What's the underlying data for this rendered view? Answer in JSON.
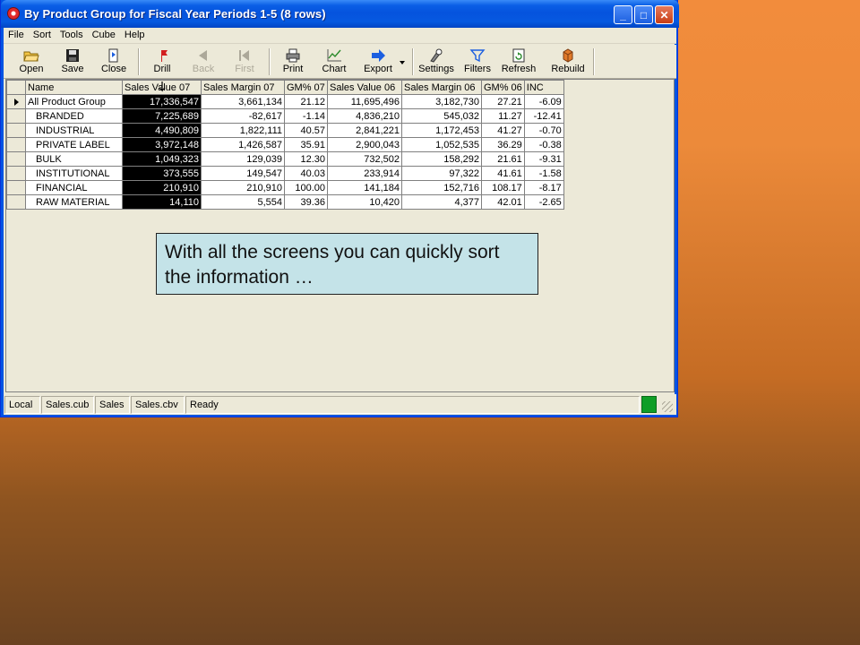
{
  "window": {
    "title": "By Product Group for Fiscal Year Periods 1-5  (8 rows)",
    "controls": {
      "minimize": "_",
      "maximize": "□",
      "close": "✕"
    }
  },
  "menu": [
    "File",
    "Sort",
    "Tools",
    "Cube",
    "Help"
  ],
  "toolbar": {
    "open": "Open",
    "save": "Save",
    "close": "Close",
    "drill": "Drill",
    "back": "Back",
    "first": "First",
    "print": "Print",
    "chart": "Chart",
    "export": "Export",
    "settings": "Settings",
    "filters": "Filters",
    "refresh": "Refresh",
    "rebuild": "Rebuild"
  },
  "grid": {
    "headers": [
      "Name",
      "Sales Value 07",
      "Sales Margin 07",
      "GM% 07",
      "Sales Value 06",
      "Sales Margin 06",
      "GM% 06",
      "INC"
    ],
    "rows": [
      [
        "All Product Group",
        "17,336,547",
        "3,661,134",
        "21.12",
        "11,695,496",
        "3,182,730",
        "27.21",
        "-6.09"
      ],
      [
        "BRANDED",
        "7,225,689",
        "-82,617",
        "-1.14",
        "4,836,210",
        "545,032",
        "11.27",
        "-12.41"
      ],
      [
        "INDUSTRIAL",
        "4,490,809",
        "1,822,111",
        "40.57",
        "2,841,221",
        "1,172,453",
        "41.27",
        "-0.70"
      ],
      [
        "PRIVATE LABEL",
        "3,972,148",
        "1,426,587",
        "35.91",
        "2,900,043",
        "1,052,535",
        "36.29",
        "-0.38"
      ],
      [
        "BULK",
        "1,049,323",
        "129,039",
        "12.30",
        "732,502",
        "158,292",
        "21.61",
        "-9.31"
      ],
      [
        "INSTITUTIONAL",
        "373,555",
        "149,547",
        "40.03",
        "233,914",
        "97,322",
        "41.61",
        "-1.58"
      ],
      [
        "FINANCIAL",
        "210,910",
        "210,910",
        "100.00",
        "141,184",
        "152,716",
        "108.17",
        "-8.17"
      ],
      [
        "RAW MATERIAL",
        "14,110",
        "5,554",
        "39.36",
        "10,420",
        "4,377",
        "42.01",
        "-2.65"
      ]
    ]
  },
  "status": {
    "location": "Local",
    "cube": "Sales.cub",
    "name": "Sales",
    "view": "Sales.cbv",
    "state": "Ready",
    "indicator_color": "#0f9e26"
  },
  "callout": "With all the screens you can quickly sort the information …"
}
